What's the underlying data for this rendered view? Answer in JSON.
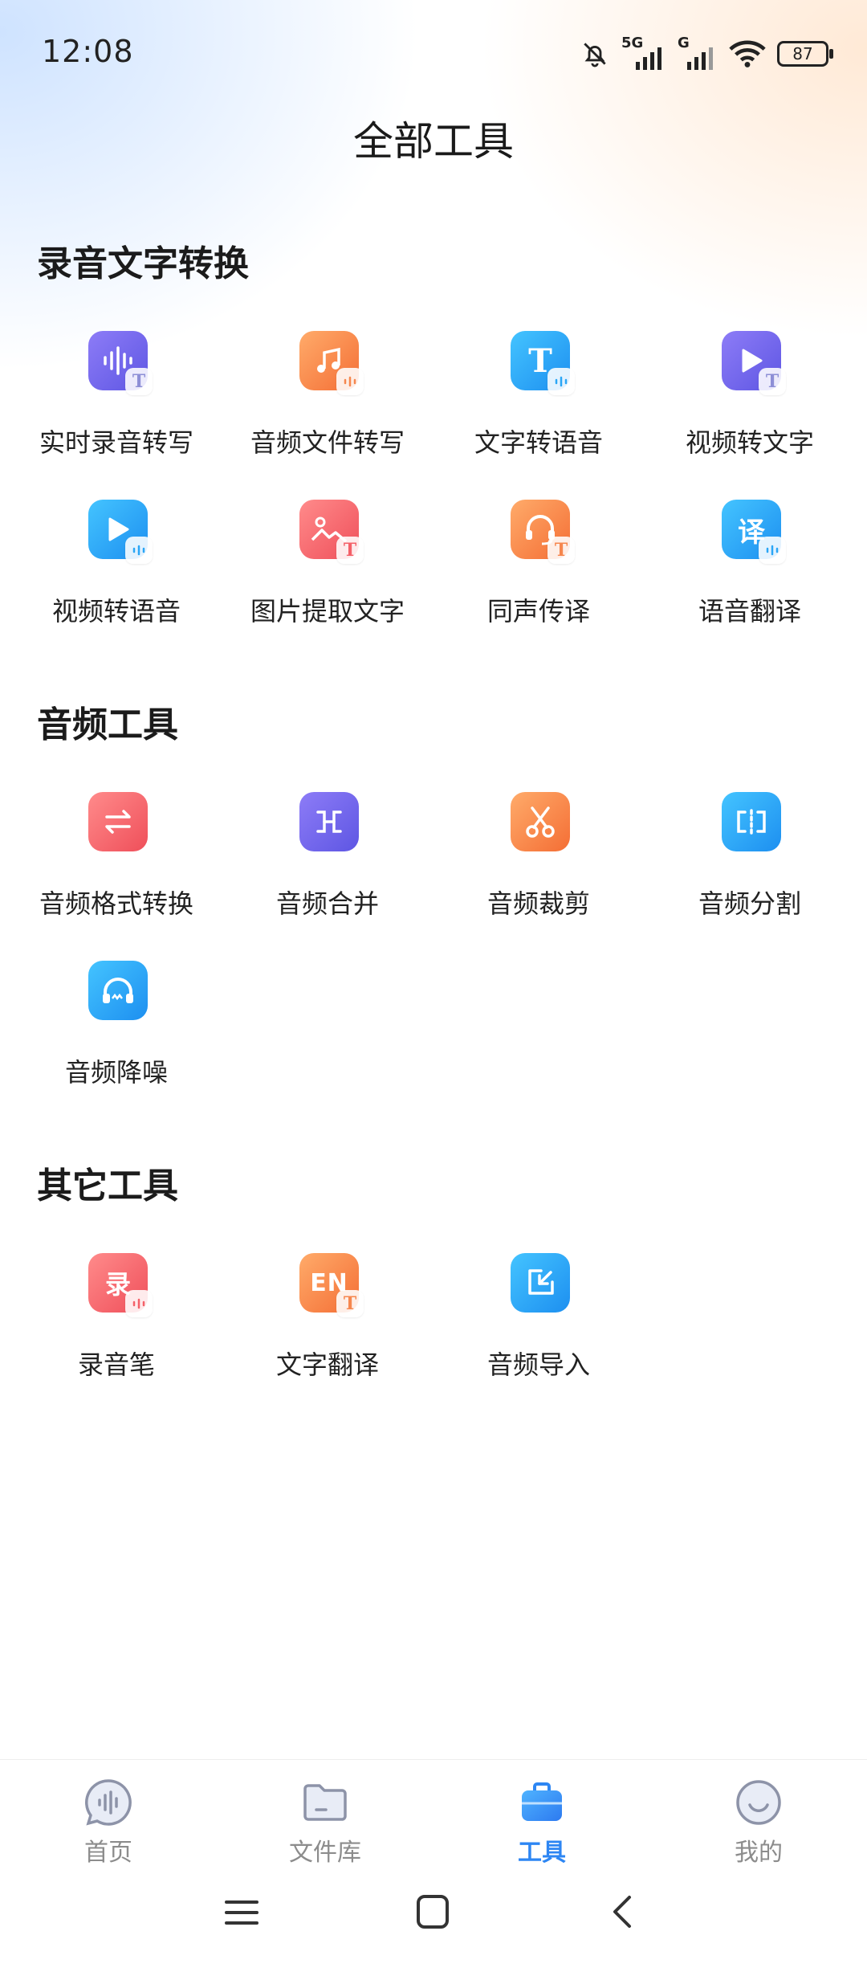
{
  "status_bar": {
    "time": "12:08",
    "battery": "87",
    "network_1": "5G",
    "network_2": "G"
  },
  "page_title": "全部工具",
  "sections": [
    {
      "title": "录音文字转换",
      "items": [
        {
          "label": "实时录音转写",
          "icon": "waveform-icon"
        },
        {
          "label": "音频文件转写",
          "icon": "music-note-icon"
        },
        {
          "label": "文字转语音",
          "icon": "text-t-icon"
        },
        {
          "label": "视频转文字",
          "icon": "play-icon"
        },
        {
          "label": "视频转语音",
          "icon": "play-icon"
        },
        {
          "label": "图片提取文字",
          "icon": "image-icon"
        },
        {
          "label": "同声传译",
          "icon": "headset-icon"
        },
        {
          "label": "语音翻译",
          "icon": "translate-icon"
        }
      ]
    },
    {
      "title": "音频工具",
      "items": [
        {
          "label": "音频格式转换",
          "icon": "swap-arrows-icon"
        },
        {
          "label": "音频合并",
          "icon": "merge-icon"
        },
        {
          "label": "音频裁剪",
          "icon": "scissors-icon"
        },
        {
          "label": "音频分割",
          "icon": "split-icon"
        },
        {
          "label": "音频降噪",
          "icon": "headphones-icon"
        }
      ]
    },
    {
      "title": "其它工具",
      "items": [
        {
          "label": "录音笔",
          "icon": "recorder-icon"
        },
        {
          "label": "文字翻译",
          "icon": "en-icon"
        },
        {
          "label": "音频导入",
          "icon": "import-icon"
        }
      ]
    }
  ],
  "icon_glyphs": {
    "text_t": "T",
    "translate": "译",
    "recorder": "录",
    "en": "EN"
  },
  "bottom_nav": [
    {
      "label": "首页",
      "icon": "voice-bubble-icon",
      "active": false
    },
    {
      "label": "文件库",
      "icon": "folder-icon",
      "active": false
    },
    {
      "label": "工具",
      "icon": "toolbox-icon",
      "active": true
    },
    {
      "label": "我的",
      "icon": "smiley-icon",
      "active": false
    }
  ],
  "colors": {
    "accent": "#2d86f3",
    "purple": "#6f63ee",
    "orange": "#f8834a",
    "blue": "#2aa6f6",
    "red": "#f46068"
  }
}
